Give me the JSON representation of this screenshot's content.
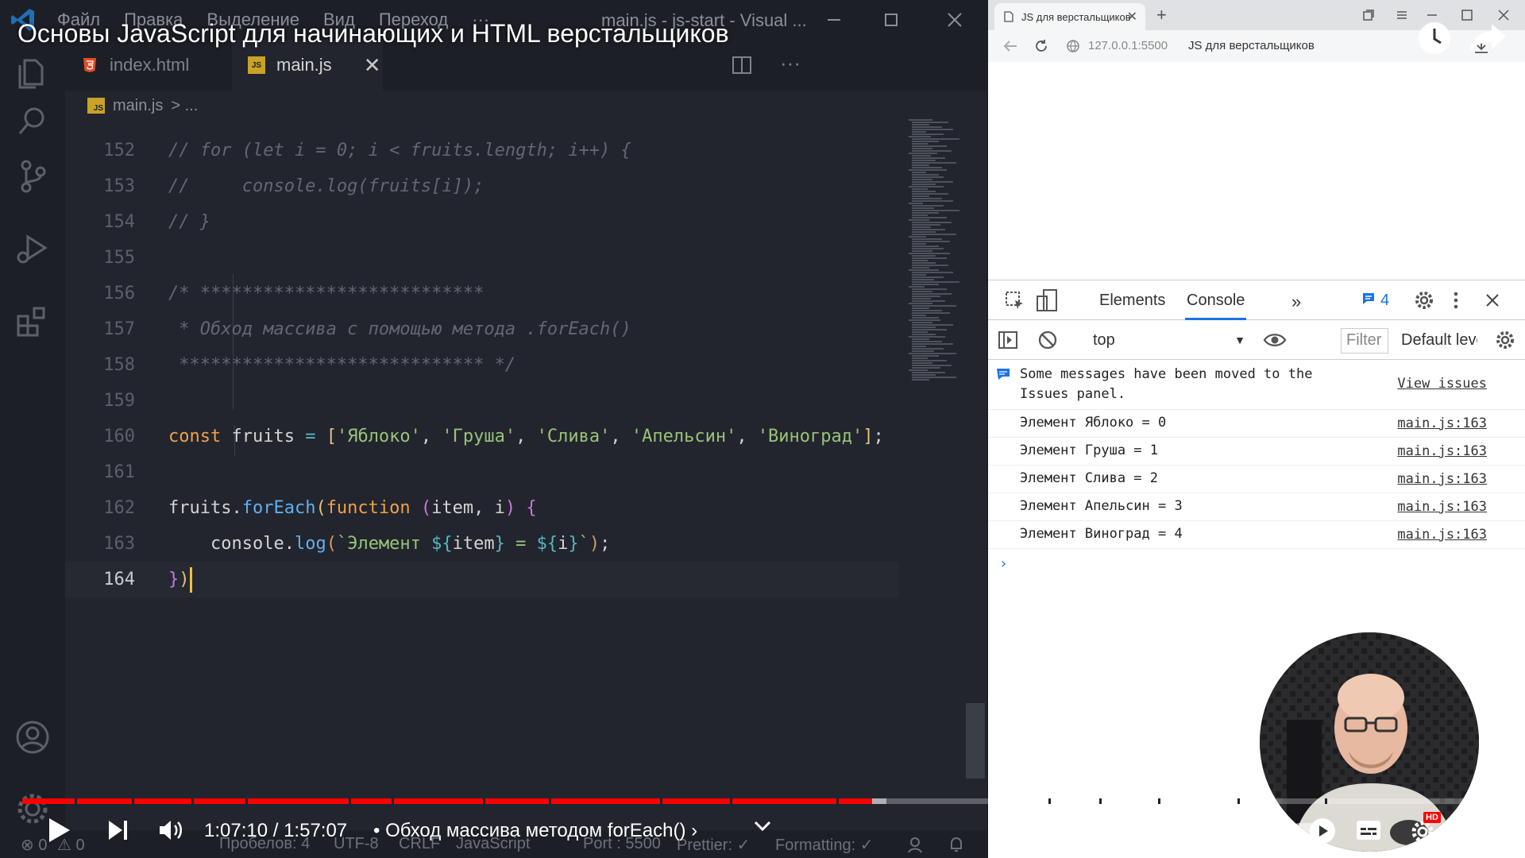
{
  "video": {
    "title": "Основы JavaScript для начинающих и HTML верстальщиков",
    "current_time": "1:07:10",
    "duration": "1:57:07",
    "time_display": "1:07:10 / 1:57:07",
    "chapter": "• Обход массива методом forEach() ›",
    "progress": 0.574,
    "quality_badge": "HD",
    "autoplay": true,
    "colors": {
      "progress": "#ff0000"
    }
  },
  "vscode": {
    "menu": [
      "Файл",
      "Правка",
      "Выделение",
      "Вид",
      "Переход",
      "···"
    ],
    "window_title": "main.js - js-start - Visual ...",
    "tabs": [
      {
        "label": "index.html",
        "icon": "html5-icon",
        "active": false
      },
      {
        "label": "main.js",
        "icon": "js-file-icon",
        "active": true
      }
    ],
    "breadcrumb": {
      "file": "main.js",
      "rest": "> ..."
    },
    "lines": [
      {
        "n": "152",
        "code": "// for (let i = 0; i < fruits.length; i++) {"
      },
      {
        "n": "153",
        "code": "//     console.log(fruits[i]);"
      },
      {
        "n": "154",
        "code": "// }"
      },
      {
        "n": "155",
        "code": ""
      },
      {
        "n": "156",
        "code": "/* ***************************"
      },
      {
        "n": "157",
        "code": " * Обход массива с помощью метода .forEach()"
      },
      {
        "n": "158",
        "code": " ***************************** */"
      },
      {
        "n": "159",
        "code": ""
      },
      {
        "n": "160",
        "code": "const fruits = ['Яблоко', 'Груша', 'Слива', 'Апельсин', 'Виноград'];"
      },
      {
        "n": "161",
        "code": ""
      },
      {
        "n": "162",
        "code": "fruits.forEach(function (item, i) {"
      },
      {
        "n": "163",
        "code": "    console.log(`Элемент ${item} = ${i}`);"
      },
      {
        "n": "164",
        "code": "})"
      }
    ],
    "status": {
      "errors": "⊗ 0",
      "warnings": "⚠ 0",
      "spaces": "Пробелов: 4",
      "encoding": "UTF-8",
      "eol": "CRLF",
      "language": "JavaScript",
      "port": "Port : 5500",
      "prettier": "Prettier: ✓",
      "formatting": "Formatting: ✓"
    }
  },
  "browser": {
    "tab_title": "JS для верстальщиков",
    "url": "127.0.0.1:5500",
    "page_title": "JS для верстальщиков",
    "devtools": {
      "tabs": [
        "Elements",
        "Console"
      ],
      "more": "»",
      "issues_count": "4",
      "context": "top",
      "filter_placeholder": "Filter",
      "levels": "Default levels",
      "info_message": "Some messages have been moved to the Issues panel.",
      "info_link": "View issues",
      "logs": [
        {
          "text": "Элемент Яблоко = 0",
          "source": "main.js:163"
        },
        {
          "text": "Элемент Груша = 1",
          "source": "main.js:163"
        },
        {
          "text": "Элемент Слива = 2",
          "source": "main.js:163"
        },
        {
          "text": "Элемент Апельсин = 3",
          "source": "main.js:163"
        },
        {
          "text": "Элемент Виноград = 4",
          "source": "main.js:163"
        }
      ],
      "prompt": "›"
    }
  }
}
